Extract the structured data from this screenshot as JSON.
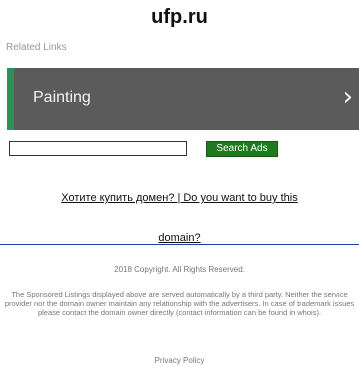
{
  "header": {
    "title": "ufp.ru"
  },
  "related": {
    "label": "Related Links"
  },
  "links": [
    {
      "label": "Painting",
      "chevron": "›"
    }
  ],
  "search": {
    "value": "",
    "placeholder": "",
    "button_label": "Search Ads"
  },
  "buy_domain": {
    "line1": "Хотите купить домен? | Do you want to buy this",
    "line2": "domain?"
  },
  "footer": {
    "copyright": "2018 Copyright. All Rights Reserved.",
    "disclaimer": "The Sponsored Listings displayed above are served automatically by a third party. Neither the service provider nor the domain owner maintain any relationship with the advertisers. In case of trademark issues please contact the domain owner directly (contact information can be found in whois).",
    "privacy": "Privacy Policy"
  },
  "colors": {
    "accent": "#29925a",
    "bar": "#5b5b5b",
    "button": "#1f7a1f",
    "rule": "#2a3b9c"
  },
  "icons": {
    "chevron": "chevron-right-icon"
  }
}
